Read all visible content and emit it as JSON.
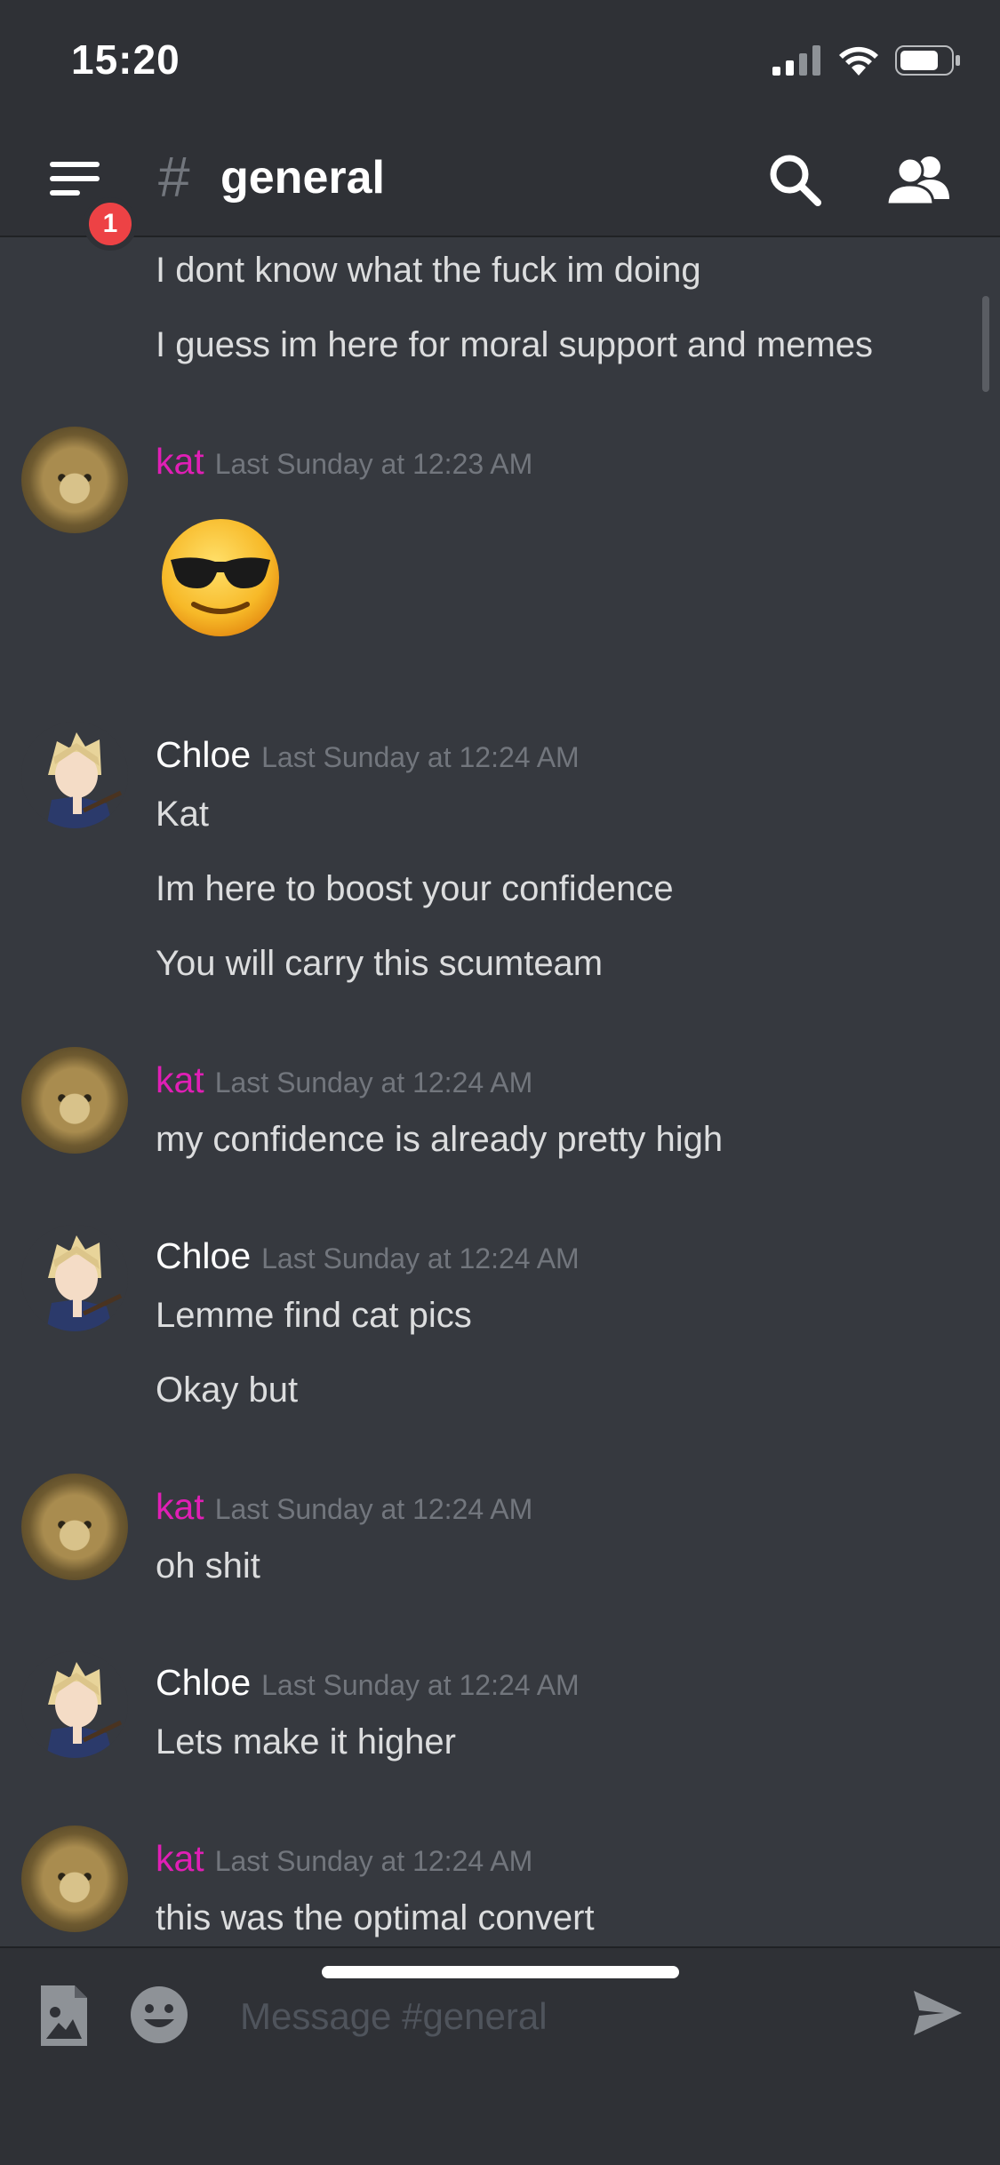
{
  "status_bar": {
    "time": "15:20"
  },
  "header": {
    "notification_count": "1",
    "channel_hash": "#",
    "channel_name": "general"
  },
  "messages": {
    "continuation": [
      "I dont know what the fuck im doing",
      "I guess im here for moral support and memes"
    ],
    "groups": [
      {
        "author": "kat",
        "timestamp": "Last Sunday at 12:23 AM",
        "lines": [],
        "emoji": "sunglasses-emoji"
      },
      {
        "author": "Chloe",
        "timestamp": "Last Sunday at 12:24 AM",
        "lines": [
          "Kat",
          "Im here to boost your confidence",
          "You will carry this scumteam"
        ]
      },
      {
        "author": "kat",
        "timestamp": "Last Sunday at 12:24 AM",
        "lines": [
          "my confidence is already pretty high"
        ]
      },
      {
        "author": "Chloe",
        "timestamp": "Last Sunday at 12:24 AM",
        "lines": [
          "Lemme find cat pics",
          "Okay but"
        ]
      },
      {
        "author": "kat",
        "timestamp": "Last Sunday at 12:24 AM",
        "lines": [
          "oh shit"
        ]
      },
      {
        "author": "Chloe",
        "timestamp": "Last Sunday at 12:24 AM",
        "lines": [
          "Lets make it higher"
        ]
      },
      {
        "author": "kat",
        "timestamp": "Last Sunday at 12:24 AM",
        "lines": [
          "this was the optimal convert"
        ]
      }
    ]
  },
  "input": {
    "placeholder": "Message #general"
  },
  "colors": {
    "background": "#36393f",
    "bars": "#2f3136",
    "kat_name": "#e01fb5",
    "badge": "#ed4245",
    "timestamp": "#72767d"
  }
}
